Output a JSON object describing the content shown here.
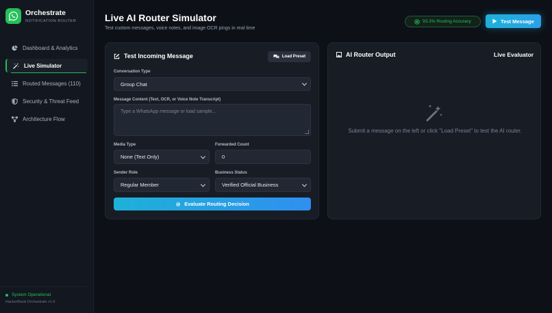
{
  "brand": {
    "title": "Orchestrate",
    "subtitle": "NOTIFICATION ROUTER"
  },
  "nav": [
    {
      "label": "Dashboard & Analytics",
      "icon": "pie-chart-icon",
      "active": false
    },
    {
      "label": "Live Simulator",
      "icon": "magic-wand-icon",
      "active": true
    },
    {
      "label": "Routed Messages (110)",
      "icon": "list-icon",
      "active": false
    },
    {
      "label": "Security & Threat Feed",
      "icon": "shield-icon",
      "active": false
    },
    {
      "label": "Architecture Flow",
      "icon": "network-icon",
      "active": false
    }
  ],
  "footer": {
    "status": "System Operational",
    "version": "HackerRank Orchestrate v1.0"
  },
  "header": {
    "title": "Live AI Router Simulator",
    "subtitle": "Test custom messages, voice notes, and image OCR pings in real time",
    "accuracy": "93.3% Routing Accuracy",
    "test_button": "Test Message"
  },
  "form": {
    "title": "Test Incoming Message",
    "load_preset": "Load Preset",
    "conversation_type": {
      "label": "Conversation Type",
      "value": "Group Chat"
    },
    "message_content": {
      "label": "Message Content (Text, OCR, or Voice Note Transcript)",
      "placeholder": "Type a WhatsApp message or load sample..."
    },
    "media_type": {
      "label": "Media Type",
      "value": "None (Text Only)"
    },
    "forwarded_count": {
      "label": "Forwarded Count",
      "value": "0"
    },
    "sender_role": {
      "label": "Sender Role",
      "value": "Regular Member"
    },
    "business_status": {
      "label": "Business Status",
      "value": "Verified Official Business"
    },
    "evaluate_button": "Evaluate Routing Decision"
  },
  "output": {
    "title": "AI Router Output",
    "badge": "Live Evaluator",
    "empty_message": "Submit a message on the left or click \"Load Preset\" to test the AI router."
  },
  "colors": {
    "accent_green": "#25c05a",
    "accent_blue": "#1eb1d8",
    "background": "#0d1117",
    "card": "#171c25"
  }
}
